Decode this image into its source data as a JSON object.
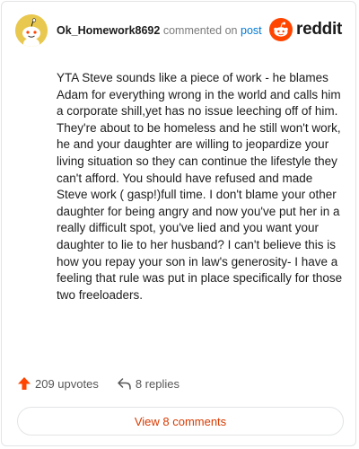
{
  "comment": {
    "username": "Ok_Homework8692",
    "action_text": "commented on",
    "post_link": "post",
    "body": "YTA Steve sounds like a piece of work - he blames Adam for everything wrong in the world and calls him a corporate shill,yet has no issue leeching off of him. They're about to be homeless and he still won't work, he and your daughter are willing to jeopardize your living situation so they can continue the lifestyle they can't afford. You should have refused and made Steve work ( gasp!)full time. I don't blame your other daughter for being angry and now you've put her in a really difficult spot, you've lied and you want your daughter to lie to her husband? I can't believe this is how you repay your son in law's generosity- I have a feeling that rule was put in place specifically for those two freeloaders."
  },
  "brand": {
    "name": "reddit",
    "color": "#ff4500",
    "icon": "reddit-snoo-icon"
  },
  "stats": {
    "upvotes": "209 upvotes",
    "upvote_icon": "upvote-arrow-icon",
    "upvote_color": "#ff4500",
    "replies": "8 replies",
    "reply_icon": "reply-arrow-icon"
  },
  "view_comments_label": "View 8 comments",
  "colors": {
    "link": "#0079d3",
    "view_button_text": "#d93a00"
  }
}
